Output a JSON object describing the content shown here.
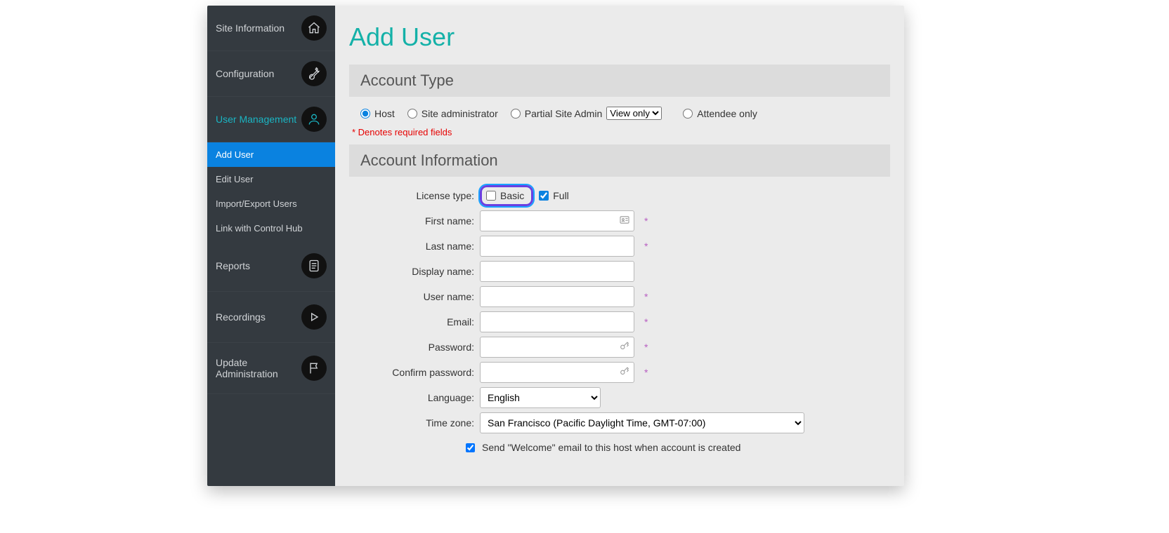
{
  "sidebar": {
    "site_information": "Site Information",
    "configuration": "Configuration",
    "user_management": "User Management",
    "reports": "Reports",
    "recordings": "Recordings",
    "update_administration": "Update Administration",
    "sub": {
      "add_user": "Add User",
      "edit_user": "Edit User",
      "import_export": "Import/Export Users",
      "link_control_hub": "Link with Control Hub"
    }
  },
  "page": {
    "title": "Add User",
    "required_note": "* Denotes required fields"
  },
  "account_type": {
    "header": "Account Type",
    "host": "Host",
    "site_admin": "Site administrator",
    "partial_site_admin": "Partial Site Admin",
    "partial_select": "View only",
    "attendee_only": "Attendee only"
  },
  "account_info": {
    "header": "Account Information",
    "license_label": "License type:",
    "license_basic": "Basic",
    "license_full": "Full",
    "first_name": "First name:",
    "last_name": "Last name:",
    "display_name": "Display name:",
    "user_name": "User name:",
    "email": "Email:",
    "password": "Password:",
    "confirm_password": "Confirm password:",
    "language": "Language:",
    "language_value": "English",
    "time_zone": "Time zone:",
    "time_zone_value": "San Francisco (Pacific Daylight Time, GMT-07:00)",
    "send_welcome": "Send \"Welcome\" email to this host when account is created",
    "star": "*"
  }
}
